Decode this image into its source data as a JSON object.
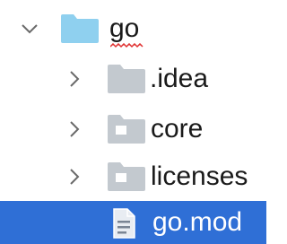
{
  "tree": {
    "root": {
      "label": "go",
      "expanded": true,
      "icon": "folder-icon",
      "color": "#8fd0ef",
      "spell_warning_color": "#e03030"
    },
    "children": [
      {
        "label": ".idea",
        "type": "folder",
        "icon": "folder-icon",
        "color": "#c3c9cf"
      },
      {
        "label": "core",
        "type": "folder",
        "icon": "folder-package-icon",
        "color": "#c3c9cf"
      },
      {
        "label": "licenses",
        "type": "folder",
        "icon": "folder-package-icon",
        "color": "#c3c9cf"
      },
      {
        "label": "go.mod",
        "type": "file",
        "icon": "file-text-icon",
        "selected": true,
        "selection_color": "#2f6fd6"
      }
    ]
  }
}
